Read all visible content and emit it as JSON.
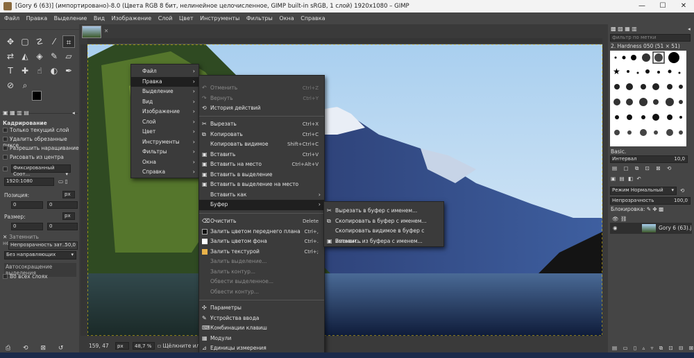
{
  "window": {
    "title": "[Gory 6 (63)] (импортировано)-8.0 (Цвета RGB 8 бит, нелинейное целочисленное, GIMP built-in sRGB, 1 слой) 1920x1080 – GIMP",
    "controls": [
      "—",
      "☐",
      "✕"
    ]
  },
  "menubar": [
    "Файл",
    "Правка",
    "Выделение",
    "Вид",
    "Изображение",
    "Слой",
    "Цвет",
    "Инструменты",
    "Фильтры",
    "Окна",
    "Справка"
  ],
  "tool_options": {
    "title": "Кадрирование",
    "current_layer_only": "Только текущий слой",
    "delete_cropped": "Удалить обрезанные пиксе",
    "allow_growing": "Разрешить наращивание",
    "from_center": "Рисовать из центра",
    "fixed_label": "Фиксированный Соот...",
    "ratio_value": "1920:1080",
    "position_label": "Позиция:",
    "position_unit": "px",
    "position_x": "0",
    "position_y": "0",
    "size_label": "Размер:",
    "size_unit": "px",
    "size_x": "0",
    "size_y": "0",
    "shade_label": "Затемнить неиспользуемое",
    "opacity_label": "Непрозрачность зат...",
    "opacity_value": "50,0",
    "guides_value": "Без направляющих",
    "autoshrink_label": "Автосокращение выделения",
    "all_layers_label": "Во всех слоях"
  },
  "statusbar": {
    "coords": "159, 47",
    "unit": "px",
    "zoom": "48,7 %",
    "message": "Щёлкните или щ"
  },
  "main_menu": {
    "items": [
      "Файл",
      "Правка",
      "Выделение",
      "Вид",
      "Изображение",
      "Слой",
      "Цвет",
      "Инструменты",
      "Фильтры",
      "Окна",
      "Справка"
    ],
    "active": "Правка"
  },
  "edit_menu": {
    "items": [
      {
        "label": "Отменить",
        "shortcut": "Ctrl+Z",
        "disabled": true,
        "icon": "undo-icon"
      },
      {
        "label": "Вернуть",
        "shortcut": "Ctrl+Y",
        "disabled": true,
        "icon": "redo-icon"
      },
      {
        "label": "История действий",
        "shortcut": "",
        "disabled": false,
        "icon": "history-icon"
      },
      {
        "label": "Вырезать",
        "shortcut": "Ctrl+X",
        "disabled": false,
        "icon": "scissors-icon"
      },
      {
        "label": "Копировать",
        "shortcut": "Ctrl+C",
        "disabled": false,
        "icon": "copy-icon"
      },
      {
        "label": "Копировать видимое",
        "shortcut": "Shift+Ctrl+C",
        "disabled": false,
        "icon": ""
      },
      {
        "label": "Вставить",
        "shortcut": "Ctrl+V",
        "disabled": false,
        "icon": "paste-icon"
      },
      {
        "label": "Вставить на место",
        "shortcut": "Ctrl+Alt+V",
        "disabled": false,
        "icon": "paste-icon"
      },
      {
        "label": "Вставить в выделение",
        "shortcut": "",
        "disabled": false,
        "icon": "paste-icon"
      },
      {
        "label": "Вставить в выделение на место",
        "shortcut": "",
        "disabled": false,
        "icon": "paste-icon"
      },
      {
        "label": "Вставить как",
        "shortcut": "",
        "disabled": false,
        "icon": "",
        "submenu": true
      },
      {
        "label": "Буфер",
        "shortcut": "",
        "disabled": false,
        "icon": "",
        "submenu": true,
        "highlighted": true
      },
      {
        "label": "Очистить",
        "shortcut": "Delete",
        "disabled": false,
        "icon": "clear-icon"
      },
      {
        "label": "Залить цветом переднего плана",
        "shortcut": "Ctrl+,",
        "disabled": false,
        "icon": "fg-swatch-icon"
      },
      {
        "label": "Залить цветом фона",
        "shortcut": "Ctrl+.",
        "disabled": false,
        "icon": "bg-swatch-icon"
      },
      {
        "label": "Залить текстурой",
        "shortcut": "Ctrl+;",
        "disabled": false,
        "icon": "pattern-icon"
      },
      {
        "label": "Залить выделение...",
        "shortcut": "",
        "disabled": true,
        "icon": ""
      },
      {
        "label": "Залить контур...",
        "shortcut": "",
        "disabled": true,
        "icon": ""
      },
      {
        "label": "Обвести выделенное...",
        "shortcut": "",
        "disabled": true,
        "icon": ""
      },
      {
        "label": "Обвести контур...",
        "shortcut": "",
        "disabled": true,
        "icon": ""
      },
      {
        "label": "Параметры",
        "shortcut": "",
        "disabled": false,
        "icon": "settings-icon"
      },
      {
        "label": "Устройства ввода",
        "shortcut": "",
        "disabled": false,
        "icon": "input-device-icon"
      },
      {
        "label": "Комбинации клавиш",
        "shortcut": "",
        "disabled": false,
        "icon": "keyboard-icon"
      },
      {
        "label": "Модули",
        "shortcut": "",
        "disabled": false,
        "icon": "modules-icon"
      },
      {
        "label": "Единицы измерения",
        "shortcut": "",
        "disabled": false,
        "icon": "units-icon"
      }
    ]
  },
  "buffer_menu": {
    "items": [
      {
        "label": "Вырезать в буфер с именем...",
        "icon": "scissors-icon"
      },
      {
        "label": "Скопировать в буфер с именем...",
        "icon": "copy-icon"
      },
      {
        "label": "Скопировать видимое в буфер с именем...",
        "icon": ""
      },
      {
        "label": "Вставить из буфера с именем...",
        "icon": "paste-icon"
      }
    ]
  },
  "brushes": {
    "filter_placeholder": "фильтр по метки",
    "brush_name": "2. Hardness 050 (51 × 51)",
    "tag": "Basic.",
    "spacing_label": "Интервал",
    "spacing_value": "10,0"
  },
  "layers": {
    "mode_label": "Режим",
    "mode_value": "Нормальный",
    "opacity_label": "Непрозрачность",
    "opacity_value": "100,0",
    "lock_label": "Блокировка:",
    "layer_name": "Gory 6 (63).j"
  }
}
